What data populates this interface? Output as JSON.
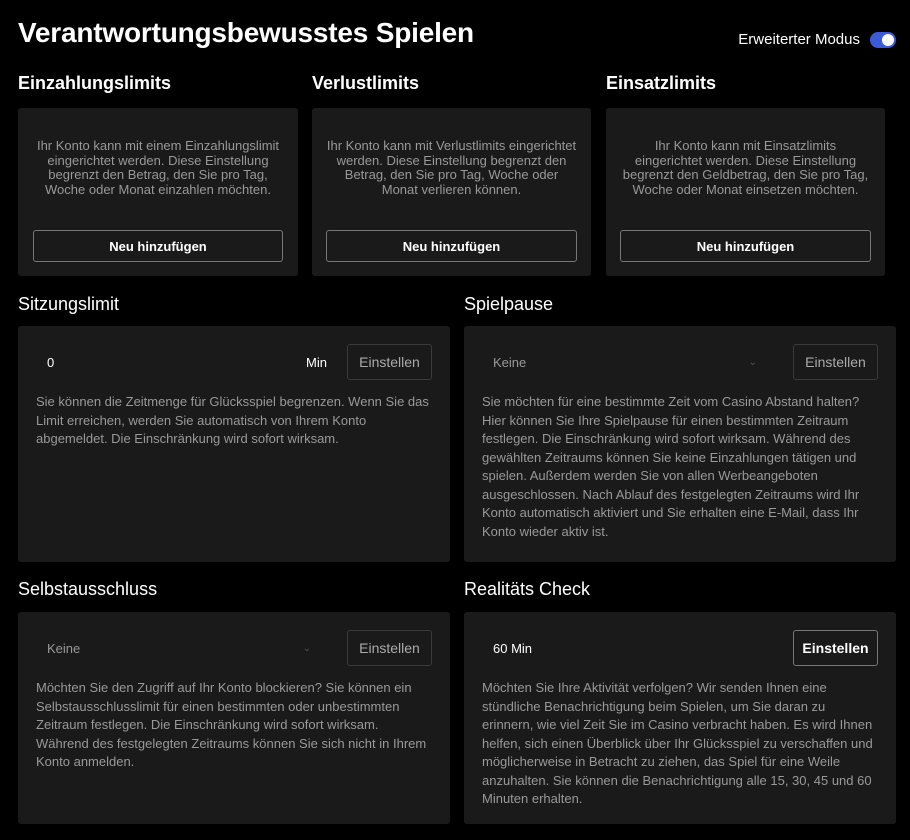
{
  "header": {
    "title": "Verantwortungsbewusstes Spielen",
    "mode_label": "Erweiterter Modus",
    "mode_on": true
  },
  "limits": [
    {
      "title": "Einzahlungslimits",
      "text": "Ihr Konto kann mit einem Einzahlungslimit eingerichtet werden. Diese Einstellung begrenzt den Betrag, den Sie pro Tag, Woche oder Monat einzahlen möchten.",
      "button": "Neu hinzufügen"
    },
    {
      "title": "Verlustlimits",
      "text": "Ihr Konto kann mit Verlustlimits eingerichtet werden. Diese Einstellung begrenzt den Betrag, den Sie pro Tag, Woche oder Monat verlieren können.",
      "button": "Neu hinzufügen"
    },
    {
      "title": "Einsatzlimits",
      "text": "Ihr Konto kann mit Einsatzlimits eingerichtet werden. Diese Einstellung begrenzt den Geldbetrag, den Sie pro Tag, Woche oder Monat einsetzen möchten.",
      "button": "Neu hinzufügen"
    }
  ],
  "session": {
    "title": "Sitzungslimit",
    "value": "0",
    "unit": "Min",
    "button": "Einstellen",
    "text": "Sie können die Zeitmenge für Glücksspiel begrenzen. Wenn Sie das Limit erreichen, werden Sie automatisch von Ihrem Konto abgemeldet. Die Einschränkung wird sofort wirksam."
  },
  "pause": {
    "title": "Spielpause",
    "selected": "Keine",
    "button": "Einstellen",
    "text": "Sie möchten für eine bestimmte Zeit vom Casino Abstand halten? Hier können Sie Ihre Spielpause für einen bestimmten Zeitraum festlegen. Die Einschränkung wird sofort wirksam. Während des gewählten Zeitraums können Sie keine Einzahlungen tätigen und spielen. Außerdem werden Sie von allen Werbeangeboten ausgeschlossen. Nach Ablauf des festgelegten Zeitraums wird Ihr Konto automatisch aktiviert und Sie erhalten eine E-Mail, dass Ihr Konto wieder aktiv ist."
  },
  "exclusion": {
    "title": "Selbstausschluss",
    "selected": "Keine",
    "button": "Einstellen",
    "text": "Möchten Sie den Zugriff auf Ihr Konto blockieren? Sie können ein Selbstausschlusslimit für einen bestimmten oder unbestimmten Zeitraum festlegen. Die Einschränkung wird sofort wirksam. Während des festgelegten Zeitraums können Sie sich nicht in Ihrem Konto anmelden."
  },
  "reality": {
    "title": "Realitäts Check",
    "selected": "60 Min",
    "button": "Einstellen",
    "text": "Möchten Sie Ihre Aktivität verfolgen? Wir senden Ihnen eine stündliche Benachrichtigung beim Spielen, um Sie daran zu erinnern, wie viel Zeit Sie im Casino verbracht haben. Es wird Ihnen helfen, sich einen Überblick über Ihr Glücksspiel zu verschaffen und möglicherweise in Betracht zu ziehen, das Spiel für eine Weile anzuhalten. Sie können die Benachrichtigung alle 15, 30, 45 und 60 Minuten erhalten."
  },
  "colors": {
    "background": "#000000",
    "card": "#1a1a1a",
    "accent": "#3d5bd9"
  },
  "icons": {
    "toggle": "toggle-switch",
    "dropdown": "chevron-down-icon"
  }
}
